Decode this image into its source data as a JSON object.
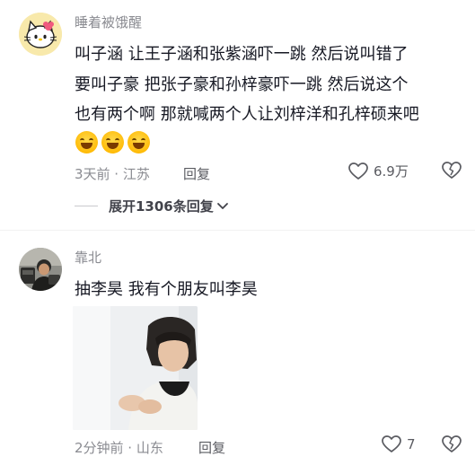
{
  "comments": [
    {
      "username": "睡着被饿醒",
      "text_lines": [
        "叫子涵 让王子涵和张紫涵吓一跳 然后说叫错了",
        "要叫子豪 把张子豪和孙梓豪吓一跳 然后说这个",
        "也有两个啊 那就喊两个人让刘梓洋和孔梓硕来吧"
      ],
      "emojis": [
        "grin-emoji",
        "grin-emoji",
        "grin-emoji"
      ],
      "time_location": "3天前 · 江苏",
      "reply_label": "回复",
      "likes": "6.9万",
      "expand_label": "展开1306条回复"
    },
    {
      "username": "靠北",
      "text_lines": [
        "抽李昊 我有个朋友叫李昊"
      ],
      "time_location": "2分钟前 · 山东",
      "reply_label": "回复",
      "likes": "7"
    }
  ],
  "icons": {
    "like": "heart-outline-icon",
    "dislike": "broken-heart-icon",
    "expand": "chevron-down-icon"
  },
  "colors": {
    "username": "#8a8b91",
    "text": "#161823",
    "meta": "#8a8b91"
  }
}
